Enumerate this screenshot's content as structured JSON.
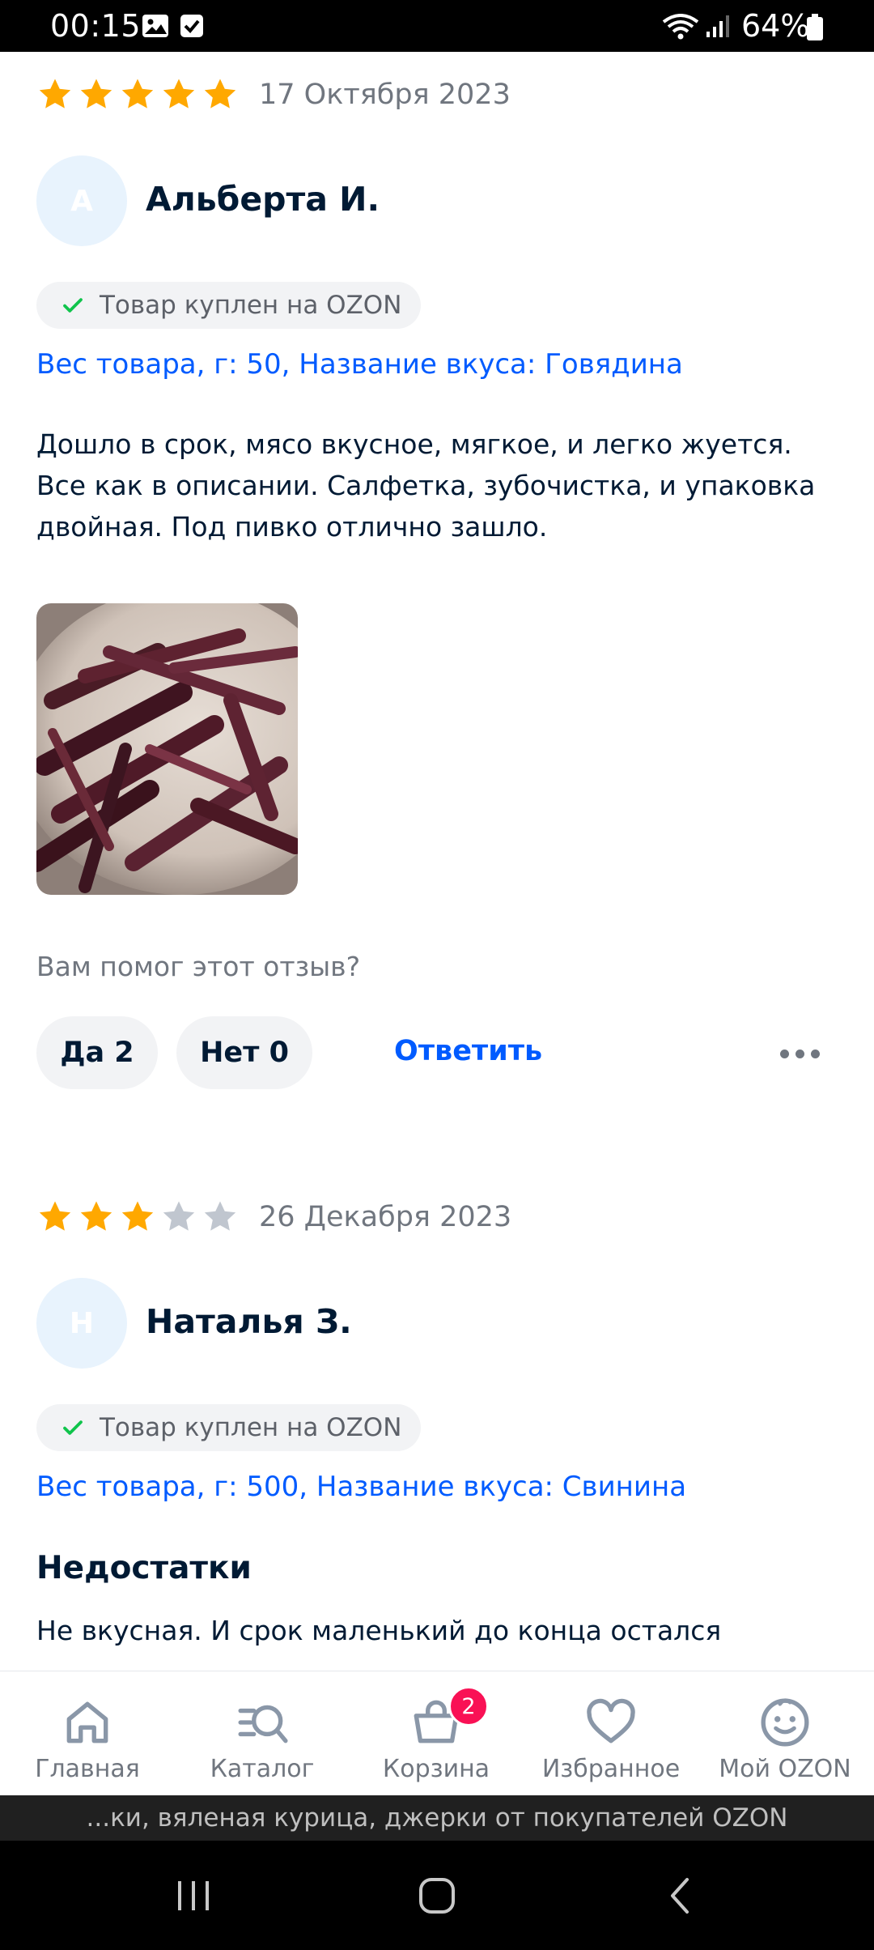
{
  "status_bar": {
    "time": "00:15",
    "battery": "64%",
    "icons": [
      "gallery-icon",
      "checkbox-icon",
      "wifi-icon",
      "signal-icon",
      "battery-icon"
    ]
  },
  "colors": {
    "accent": "#005bff",
    "star_on": "#ffa800",
    "star_off": "#c0c6cf",
    "badge": "#f91155",
    "check": "#10c44c"
  },
  "reviews": [
    {
      "rating": 5,
      "date": "17 Октября 2023",
      "avatar_letter": "А",
      "author": "Альберта И.",
      "purchased_label": "Товар куплен на OZON",
      "variant": "Вес товара, г: 50, Название вкуса: Говядина",
      "text_lines": [
        "Дошло в срок, мясо вкусное, мягкое, и легко жуется.",
        "Все как в описании. Салфетка, зубочистка, и упаковка",
        "двойная. Под пивко отлично зашло."
      ],
      "helpful_question": "Вам помог этот отзыв?",
      "yes_label": "Да 2",
      "no_label": "Нет 0",
      "reply_label": "Ответить"
    },
    {
      "rating": 3,
      "date": "26 Декабря 2023",
      "avatar_letter": "Н",
      "author": "Наталья З.",
      "purchased_label": "Товар куплен на OZON",
      "variant": "Вес товара, г: 500, Название вкуса: Свинина",
      "section_title": "Недостатки",
      "text": "Не вкусная. И срок маленький до конца остался"
    }
  ],
  "bottom_nav": [
    {
      "label": "Главная",
      "icon": "home-icon"
    },
    {
      "label": "Каталог",
      "icon": "catalog-search-icon"
    },
    {
      "label": "Корзина",
      "icon": "basket-icon",
      "badge": "2"
    },
    {
      "label": "Избранное",
      "icon": "heart-icon"
    },
    {
      "label": "Мой OZON",
      "icon": "smiley-profile-icon"
    }
  ],
  "page_title_strip": "...ки, вяленая курица, джерки от покупателей OZON",
  "system_nav": [
    "recent-apps-icon",
    "home-circle-icon",
    "back-icon"
  ]
}
